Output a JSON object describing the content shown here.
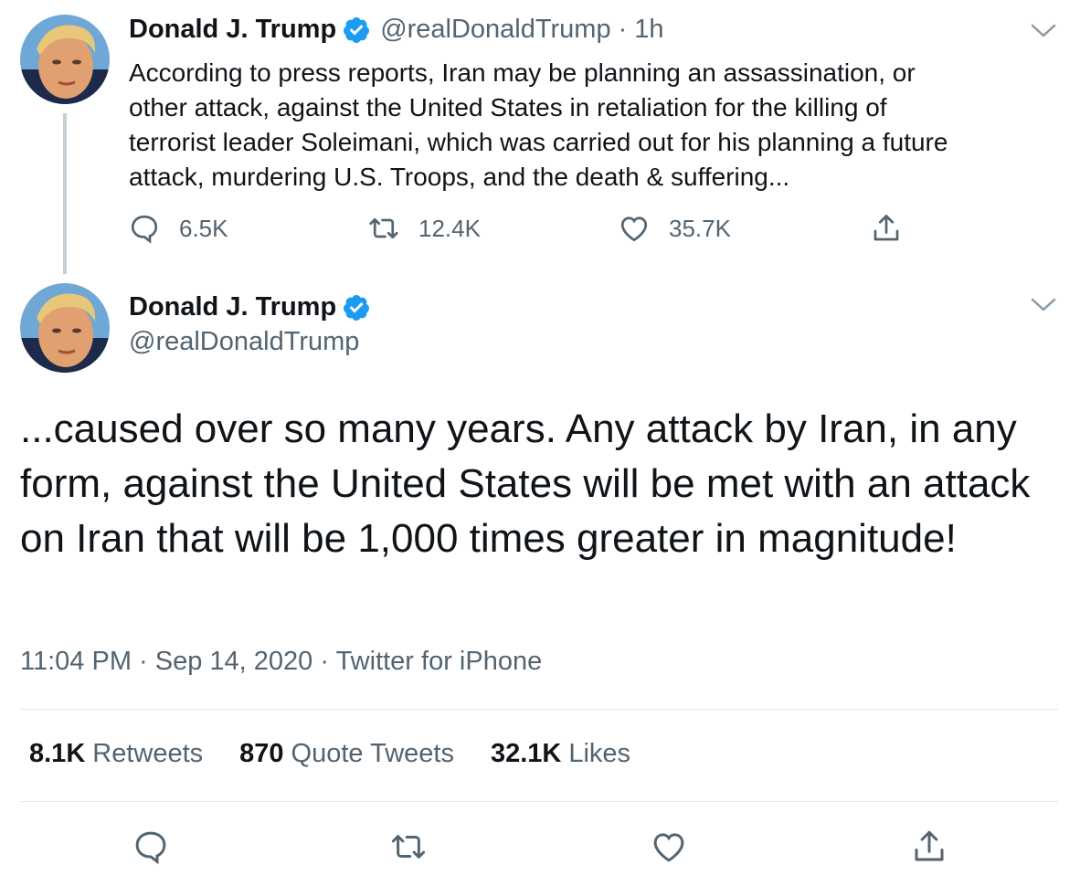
{
  "tweet1": {
    "display_name": "Donald J. Trump",
    "handle": "@realDonaldTrump",
    "separator": "·",
    "time_ago": "1h",
    "text": "According to press reports, Iran may be planning an assassination, or\nother attack, against the United States in retaliation for the killing of\nterrorist leader Soleimani, which was carried out for his planning a future\nattack, murdering U.S. Troops, and the death & suffering...",
    "reply_count": "6.5K",
    "retweet_count": "12.4K",
    "like_count": "35.7K"
  },
  "tweet2": {
    "display_name": "Donald J. Trump",
    "handle": "@realDonaldTrump",
    "text": "...caused over so many years. Any attack by Iran, in any form, against the United States will be met with an attack on Iran that will be 1,000 times greater in magnitude!",
    "time": "11:04 PM",
    "date": "Sep 14, 2020",
    "source": "Twitter for iPhone",
    "meta_separator": " · ",
    "stats": {
      "retweets_num": "8.1K",
      "retweets_label": "Retweets",
      "quotes_num": "870",
      "quotes_label": "Quote Tweets",
      "likes_num": "32.1K",
      "likes_label": "Likes"
    }
  },
  "icons": {
    "verified": "verified-badge-icon",
    "caret": "chevron-down-icon",
    "reply": "reply-icon",
    "retweet": "retweet-icon",
    "like": "heart-icon",
    "share": "share-icon"
  },
  "colors": {
    "verified_blue": "#1d9bf0",
    "secondary_text": "#536471",
    "primary_text": "#0f1419",
    "thread_line": "#c4cfd6",
    "divider": "#e1e8ed"
  }
}
